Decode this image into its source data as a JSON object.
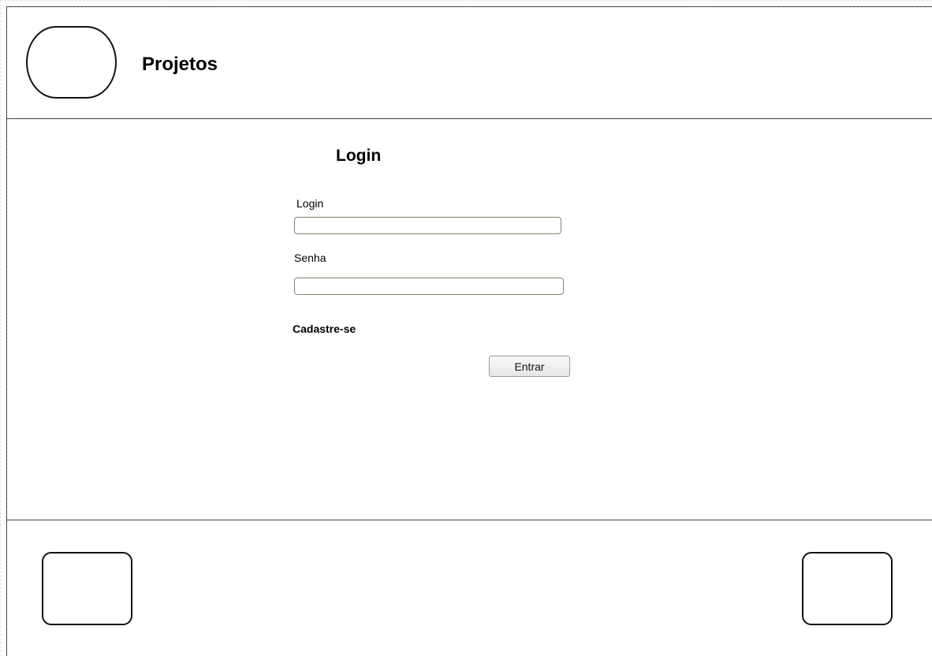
{
  "header": {
    "app_title": "Projetos"
  },
  "login_form": {
    "heading": "Login",
    "login_label": "Login",
    "login_value": "",
    "password_label": "Senha",
    "password_value": "",
    "signup_link": "Cadastre-se",
    "submit_label": "Entrar"
  },
  "colors": {
    "border": "#444444",
    "input_border": "#8a8070",
    "button_bg": "#eeeeee"
  }
}
